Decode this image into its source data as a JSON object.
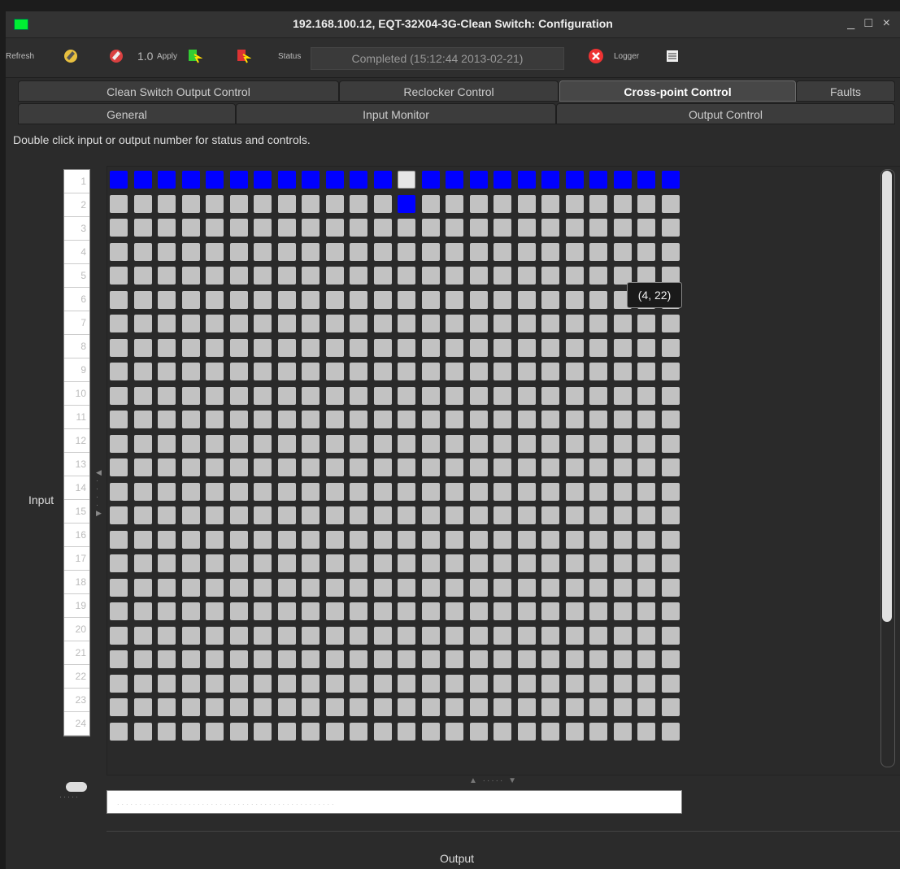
{
  "window": {
    "title": "192.168.100.12, EQT-32X04-3G-Clean Switch: Configuration",
    "controls": "_ □ ×"
  },
  "toolbar": {
    "refresh_label": "Refresh",
    "apply_value": "1.0",
    "apply_label": "Apply",
    "status_label": "Status",
    "status_value": "Completed  (15:12:44  2013-02-21)",
    "logger_label": "Logger"
  },
  "tabs_top": [
    {
      "label": "Clean Switch Output Control"
    },
    {
      "label": "Reclocker Control"
    },
    {
      "label": "Cross-point Control",
      "active": true
    },
    {
      "label": "Faults"
    }
  ],
  "tabs_bottom": [
    {
      "label": "General"
    },
    {
      "label": "Input Monitor"
    },
    {
      "label": "Output Control"
    }
  ],
  "hint": "Double click input or output number for status and controls.",
  "axis": {
    "input_label": "Input",
    "output_label": "Output"
  },
  "rows": [
    "1",
    "2",
    "3",
    "4",
    "5",
    "6",
    "7",
    "8",
    "9",
    "10",
    "11",
    "12",
    "13",
    "14",
    "15",
    "16",
    "17",
    "18",
    "19",
    "20",
    "21",
    "22",
    "23",
    "24"
  ],
  "columns_visible": 24,
  "crosspoints": {
    "row1_active_cols": [
      1,
      2,
      3,
      4,
      5,
      6,
      7,
      8,
      9,
      10,
      11,
      12,
      14,
      15,
      16,
      17,
      18,
      19,
      20,
      21,
      22,
      23,
      24
    ],
    "row1_highlight_col": 13,
    "row2_active_cols": [
      13
    ]
  },
  "tooltip": "(4, 22)",
  "colors": {
    "active": "#0000ff",
    "inactive": "#c2c2c2"
  }
}
